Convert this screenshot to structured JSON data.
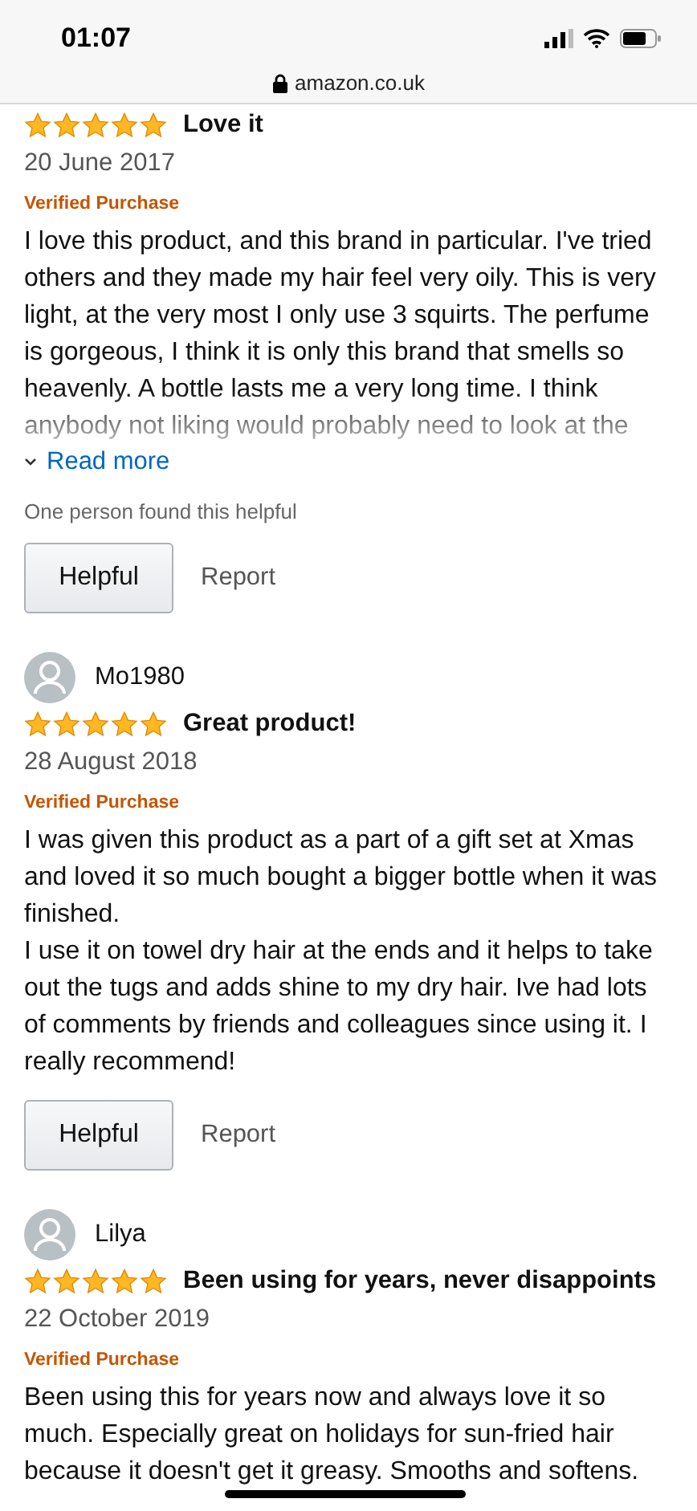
{
  "status_bar": {
    "time": "01:07"
  },
  "address_bar": {
    "url": "amazon.co.uk"
  },
  "reviews": [
    {
      "stars": 5,
      "title": "Love it",
      "date": "20 June 2017",
      "badge": "Verified Purchase",
      "body": [
        "I love this product, and this brand in particular. I've tried others and they made my hair feel very oily. This is very light, at the very most I only use 3 squirts. The perfume is gorgeous, I think it is only this brand that smells so heavenly. A bottle lasts me a very long time. I think anybody not liking would probably need to look at the"
      ],
      "truncated": true,
      "read_more": "Read more",
      "helpful_count": "One person found this helpful",
      "buttons": {
        "helpful": "Helpful",
        "report": "Report"
      }
    },
    {
      "reviewer": "Mo1980",
      "stars": 5,
      "title": "Great product!",
      "date": "28 August 2018",
      "badge": "Verified Purchase",
      "body": [
        "I was given this product as a part of a gift set at Xmas and loved it so much bought a bigger bottle when it was finished.",
        "I use it on towel dry hair at the ends and it helps to take out the tugs and adds shine to my dry hair. Ive had lots of comments by friends and colleagues since using it. I really recommend!"
      ],
      "truncated": false,
      "buttons": {
        "helpful": "Helpful",
        "report": "Report"
      }
    },
    {
      "reviewer": "Lilya",
      "stars": 5,
      "title": "Been using for years, never disappoints",
      "date": "22 October 2019",
      "badge": "Verified Purchase",
      "body": [
        "Been using this for years now and always love it so much. Especially great on holidays for sun-fried hair because it doesn't get it greasy. Smooths and softens."
      ],
      "truncated": false
    }
  ]
}
